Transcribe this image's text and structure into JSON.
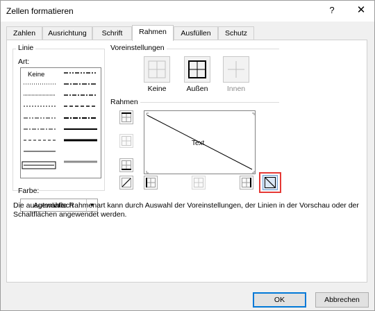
{
  "window": {
    "title": "Zellen formatieren",
    "help_glyph": "?",
    "close_glyph": "✕"
  },
  "tabs": [
    {
      "label": "Zahlen"
    },
    {
      "label": "Ausrichtung"
    },
    {
      "label": "Schrift"
    },
    {
      "label": "Rahmen",
      "active": true
    },
    {
      "label": "Ausfüllen"
    },
    {
      "label": "Schutz"
    }
  ],
  "line_group": {
    "title": "Linie",
    "style_label": "Art:",
    "none_style_label": "Keine",
    "color_label": "Farbe:",
    "color_value": "Automatisch"
  },
  "presets": {
    "title": "Voreinstellungen",
    "items": [
      {
        "label": "Keine",
        "enabled": true
      },
      {
        "label": "Außen",
        "enabled": true
      },
      {
        "label": "Innen",
        "enabled": false
      }
    ]
  },
  "border": {
    "title": "Rahmen",
    "preview_text": "Text"
  },
  "description": "Die ausgewählte Rahmenart kann durch Auswahl der Voreinstellungen, der Linien in der Vorschau oder der Schaltflächen angewendet werden.",
  "buttons": {
    "ok": "OK",
    "cancel": "Abbrechen"
  },
  "colors": {
    "highlight": "#e53935",
    "ok_border": "#0078d7"
  }
}
